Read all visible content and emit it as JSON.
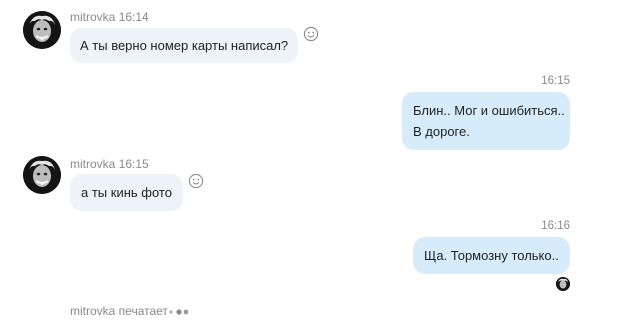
{
  "messages": [
    {
      "direction": "incoming",
      "author": "mitrovka",
      "time": "16:14",
      "lines": [
        "А ты верно номер карты написал?"
      ]
    },
    {
      "direction": "outgoing",
      "time": "16:15",
      "lines": [
        "Блин.. Мог и ошибиться..",
        "В дороге."
      ]
    },
    {
      "direction": "incoming",
      "author": "mitrovka",
      "time": "16:15",
      "lines": [
        "а ты кинь фото"
      ]
    },
    {
      "direction": "outgoing",
      "time": "16:16",
      "lines": [
        "Ща. Тормозну только.."
      ]
    }
  ],
  "typing_indicator": "mitrovka печатает",
  "colors": {
    "incoming_bubble": "#eef3f7",
    "outgoing_bubble": "#d6ecfb",
    "meta_text": "#8a8a8a"
  },
  "icons": {
    "avatar": "contact-avatar-icon",
    "reaction": "smiley-icon",
    "read_receipt": "read-receipt-avatar-icon",
    "typing": "typing-dots-icon"
  }
}
